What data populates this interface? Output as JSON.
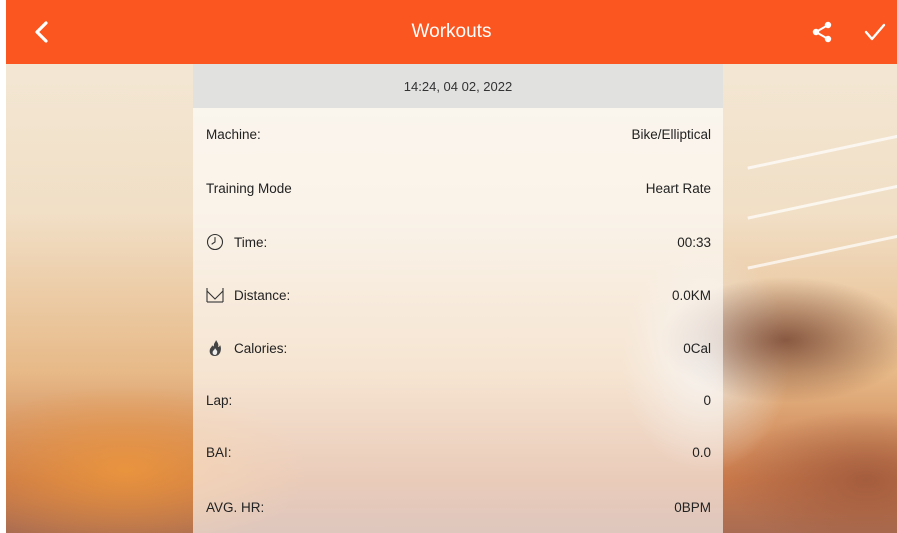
{
  "header": {
    "title": "Workouts",
    "back_icon": "chevron-left-icon",
    "share_icon": "share-icon",
    "confirm_icon": "check-icon"
  },
  "session": {
    "datetime": "14:24, 04 02, 2022"
  },
  "rows": [
    {
      "label": "Machine:",
      "value": "Bike/Elliptical",
      "icon": ""
    },
    {
      "label": "Training Mode",
      "value": "Heart Rate",
      "icon": ""
    },
    {
      "label": "Time:",
      "value": "00:33",
      "icon": "clock-icon"
    },
    {
      "label": "Distance:",
      "value": "0.0KM",
      "icon": "distance-icon"
    },
    {
      "label": "Calories:",
      "value": "0Cal",
      "icon": "flame-icon"
    },
    {
      "label": "Lap:",
      "value": "0",
      "icon": ""
    },
    {
      "label": "BAI:",
      "value": "0.0",
      "icon": ""
    },
    {
      "label": "AVG. HR:",
      "value": "0BPM",
      "icon": ""
    }
  ],
  "colors": {
    "accent": "#fc5620",
    "date_bar": "#dedede",
    "text": "#222222"
  }
}
